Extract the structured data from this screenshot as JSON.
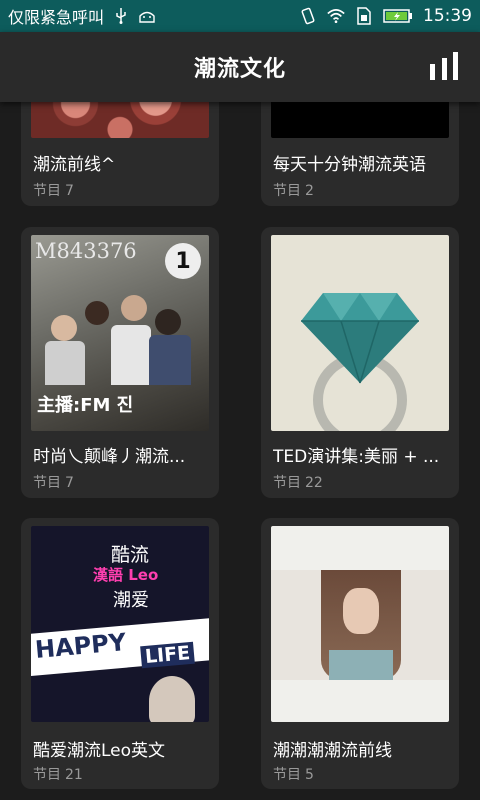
{
  "statusbar": {
    "carrier": "仅限紧急呼叫",
    "time": "15:39"
  },
  "appbar": {
    "title": "潮流文化",
    "action_icon": "bar-chart-icon"
  },
  "count_label": "节目",
  "cards": [
    {
      "title": "潮流前线^",
      "count": "7"
    },
    {
      "title": "每天十分钟潮流英语",
      "count": "2"
    },
    {
      "title": "时尚乀颠峰丿潮流...",
      "count": "7",
      "thumb_text": "M843376",
      "thumb_sub": "主播:FM 진",
      "thumb_badge": "1"
    },
    {
      "title": "TED演讲集:美丽 + ...",
      "count": "22"
    },
    {
      "title": "酷爱潮流Leo英文",
      "count": "21",
      "thumb_lines": [
        "酷流",
        "漢語 Leo",
        "潮爱",
        "HAPPY",
        "LIFE"
      ]
    },
    {
      "title": "潮潮潮潮流前线",
      "count": "5"
    }
  ],
  "colors": {
    "statusbar": "#0d5c5c",
    "appbar": "#2a2a2a",
    "card": "#2b2b2b",
    "background": "#1c1c1c"
  }
}
